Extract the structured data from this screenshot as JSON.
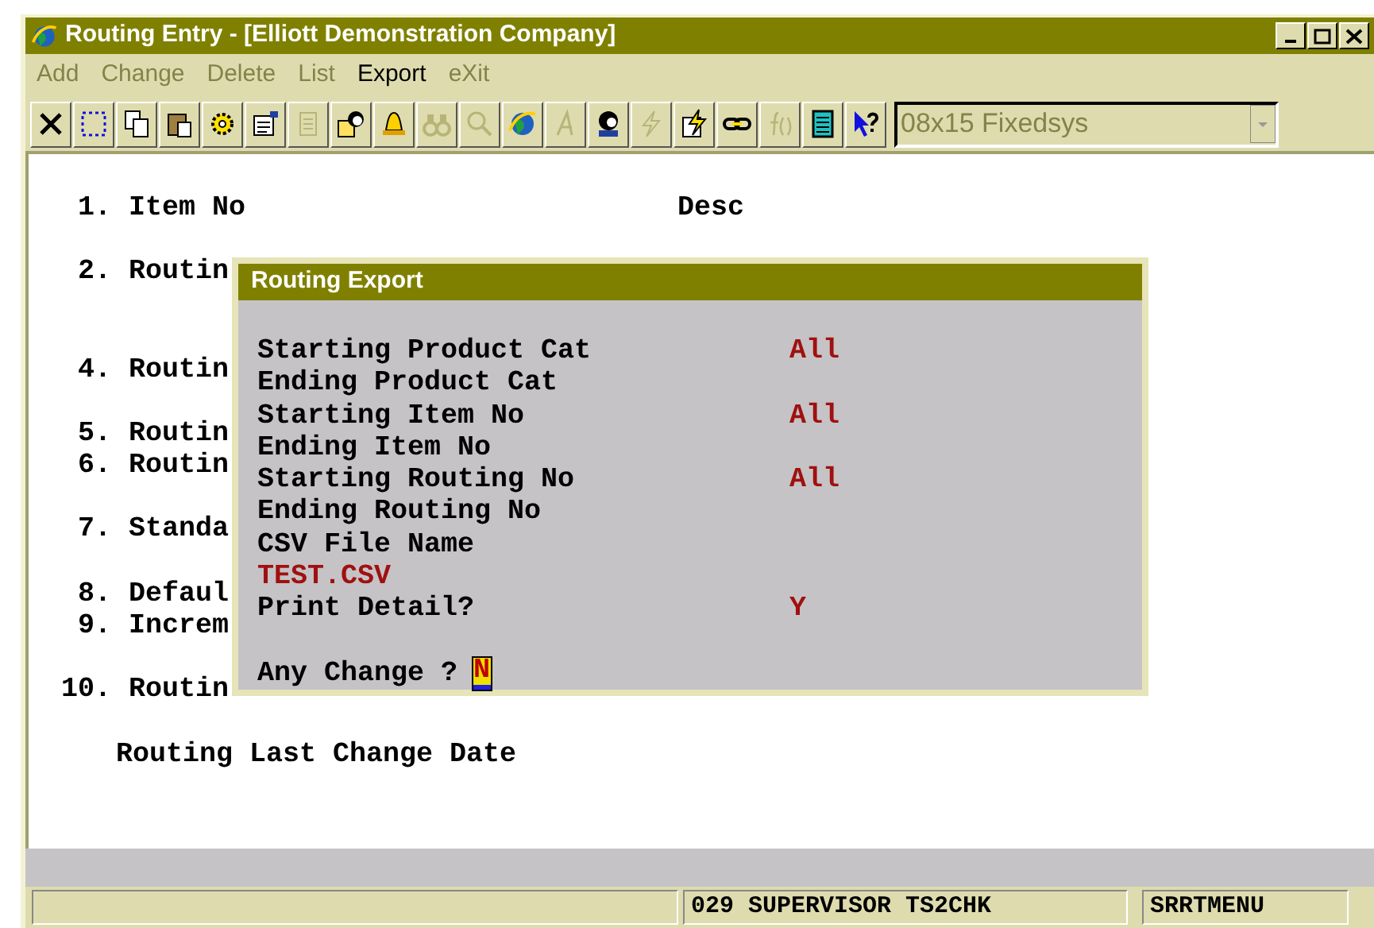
{
  "window": {
    "title": "Routing Entry - [Elliott Demonstration Company]"
  },
  "menu": [
    {
      "label": "Add",
      "disabled": true
    },
    {
      "label": "Change",
      "disabled": true
    },
    {
      "label": "Delete",
      "disabled": true
    },
    {
      "label": "List",
      "disabled": true
    },
    {
      "label": "Export",
      "disabled": false
    },
    {
      "label": "eXit",
      "disabled": true
    }
  ],
  "toolbar": [
    {
      "kind": "close",
      "disabled": false
    },
    {
      "kind": "select",
      "disabled": false
    },
    {
      "kind": "copy",
      "disabled": false
    },
    {
      "kind": "paste",
      "disabled": false
    },
    {
      "kind": "gear",
      "disabled": false
    },
    {
      "kind": "properties",
      "disabled": false
    },
    {
      "kind": "list",
      "disabled": true
    },
    {
      "kind": "person-doc",
      "disabled": false
    },
    {
      "kind": "bell",
      "disabled": false
    },
    {
      "kind": "binoculars",
      "disabled": true
    },
    {
      "kind": "search",
      "disabled": true
    },
    {
      "kind": "globe",
      "disabled": false
    },
    {
      "kind": "letter",
      "disabled": true
    },
    {
      "kind": "person",
      "disabled": false
    },
    {
      "kind": "lightning",
      "disabled": true
    },
    {
      "kind": "lightning-doc",
      "disabled": false
    },
    {
      "kind": "link",
      "disabled": false
    },
    {
      "kind": "function",
      "disabled": true
    },
    {
      "kind": "notepad",
      "disabled": false
    },
    {
      "kind": "help",
      "disabled": false
    }
  ],
  "font_select": {
    "value": "08x15 Fixedsys",
    "disabled": true
  },
  "fields": [
    {
      "number": "1.",
      "label": "Item No"
    },
    {
      "number": "2.",
      "label": "Routin"
    },
    {
      "number": "4.",
      "label": "Routin"
    },
    {
      "number": "5.",
      "label": "Routin"
    },
    {
      "number": "6.",
      "label": "Routin"
    },
    {
      "number": "7.",
      "label": "Standa"
    },
    {
      "number": "8.",
      "label": "Defaul"
    },
    {
      "number": "9.",
      "label": "Increm"
    },
    {
      "number": "10.",
      "label": "Routin"
    }
  ],
  "desc_label": "Desc",
  "last_change_label": "Routing Last Change Date",
  "dialog": {
    "title": "Routing Export",
    "rows": [
      {
        "label": "Starting Product Cat",
        "value": "All"
      },
      {
        "label": "Ending Product Cat"
      },
      {
        "label": "Starting Item No",
        "value": "All"
      },
      {
        "label": "Ending Item No"
      },
      {
        "label": "Starting Routing No",
        "value": "All"
      },
      {
        "label": "Ending Routing No"
      },
      {
        "label": "CSV File Name"
      },
      {
        "value": "TEST.CSV"
      },
      {
        "label": "Print Detail?",
        "value": "Y"
      }
    ],
    "prompt": "Any Change ?",
    "answer": "N"
  },
  "status_bar": [
    "029 SUPERVISOR TS2CHK",
    "SRRTMENU"
  ]
}
